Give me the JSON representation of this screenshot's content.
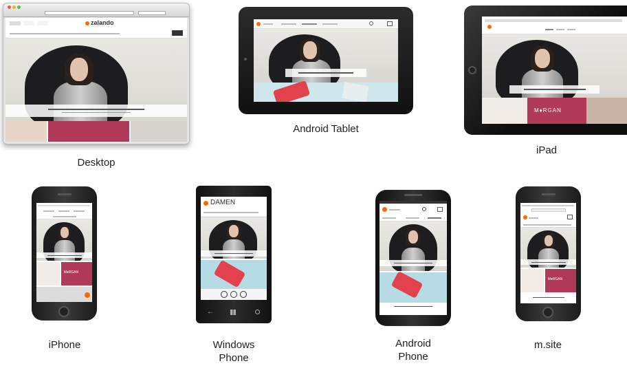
{
  "labels": {
    "desktop": "Desktop",
    "android_tablet": "Android Tablet",
    "ipad": "iPad",
    "iphone": "iPhone",
    "windows_phone_line1": "Windows",
    "windows_phone_line2": "Phone",
    "android_phone_line1": "Android",
    "android_phone_line2": "Phone",
    "msite": "m.site"
  },
  "screen_text": {
    "brand": "zalando",
    "morgan": "M♦RGAN",
    "windows_header": "DAMEN"
  },
  "icons": {
    "brand_dot": "orange-dot-logo-icon",
    "home_button": "home-button-icon",
    "windows_back": "back-arrow-icon",
    "windows_start": "windows-logo-icon",
    "windows_search": "search-icon"
  },
  "colors": {
    "brand_orange": "#ff6a00",
    "tile_red": "#c23b53",
    "tile_blue": "#b7dbe4",
    "device_black": "#1b1b1b"
  }
}
